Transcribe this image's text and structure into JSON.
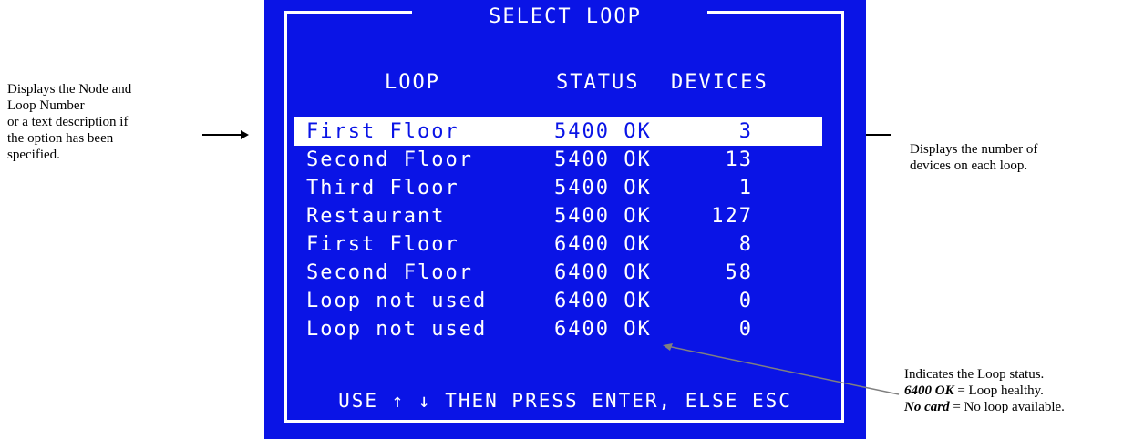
{
  "screen": {
    "title": "SELECT LOOP",
    "headers": {
      "loop": "LOOP",
      "status": "STATUS",
      "devices": "DEVICES"
    },
    "rows": [
      {
        "name": "First Floor",
        "status": "5400 OK",
        "devices": "3",
        "selected": true
      },
      {
        "name": "Second Floor",
        "status": "5400 OK",
        "devices": "13",
        "selected": false
      },
      {
        "name": "Third Floor",
        "status": "5400 OK",
        "devices": "1",
        "selected": false
      },
      {
        "name": "Restaurant",
        "status": "5400 OK",
        "devices": "127",
        "selected": false
      },
      {
        "name": "First Floor",
        "status": "6400 OK",
        "devices": "8",
        "selected": false
      },
      {
        "name": "Second Floor",
        "status": "6400 OK",
        "devices": "58",
        "selected": false
      },
      {
        "name": "Loop not used",
        "status": "6400 OK",
        "devices": "0",
        "selected": false
      },
      {
        "name": "Loop not used",
        "status": "6400 OK",
        "devices": "0",
        "selected": false
      }
    ],
    "footer": "USE ↑ ↓ THEN PRESS ENTER, ELSE ESC",
    "colors": {
      "background": "#0a14e6",
      "foreground": "#ffffff"
    }
  },
  "annotations": {
    "left": {
      "line1": "Displays the Node and",
      "line2": "Loop Number",
      "line3": "or a text description if",
      "line4": "the option has been",
      "line5": "specified."
    },
    "right": {
      "line1": "Displays the number of",
      "line2": "devices on each loop."
    },
    "bottom": {
      "line1": "Indicates the Loop status.",
      "line2_bold": "6400 OK",
      "line2_rest": " = Loop healthy.",
      "line3_bold": "No card",
      "line3_rest": " = No loop available."
    }
  }
}
